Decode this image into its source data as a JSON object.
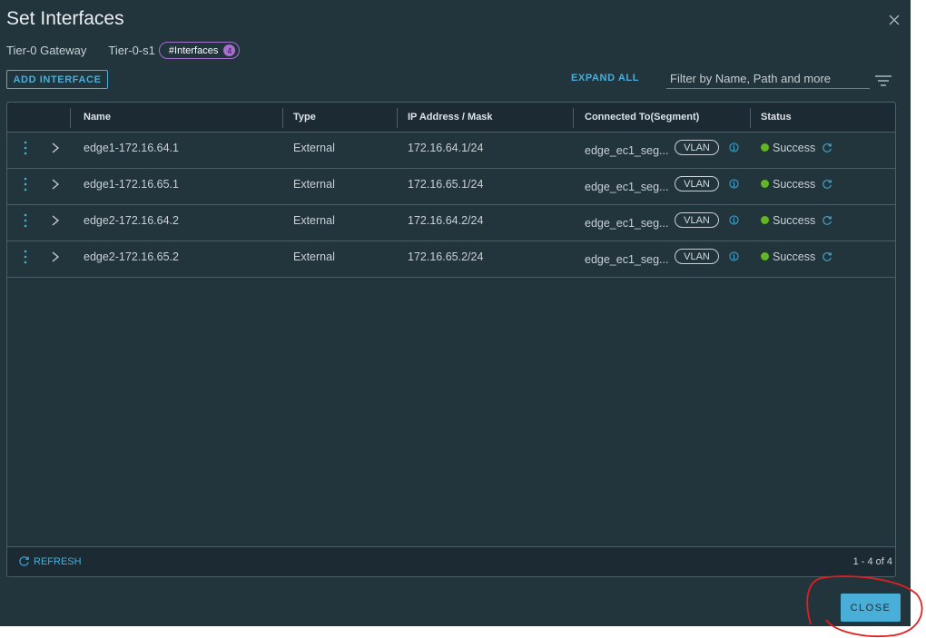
{
  "modal": {
    "title": "Set Interfaces",
    "breadcrumb": {
      "gateway_type": "Tier-0 Gateway",
      "gateway_name": "Tier-0-s1",
      "interfaces_pill_label": "#Interfaces",
      "interfaces_count": "4"
    },
    "toolbar": {
      "add_interface_label": "ADD INTERFACE",
      "expand_all_label": "EXPAND ALL",
      "filter_placeholder": "Filter by Name, Path and more",
      "filter_value": ""
    },
    "table": {
      "columns": [
        "Name",
        "Type",
        "IP Address / Mask",
        "Connected To(Segment)",
        "Status"
      ],
      "rows": [
        {
          "name": "edge1-172.16.64.1",
          "type": "External",
          "ip": "172.16.64.1/24",
          "segment": "edge_ec1_seg...",
          "segment_badge": "VLAN",
          "status": "Success"
        },
        {
          "name": "edge1-172.16.65.1",
          "type": "External",
          "ip": "172.16.65.1/24",
          "segment": "edge_ec1_seg...",
          "segment_badge": "VLAN",
          "status": "Success"
        },
        {
          "name": "edge2-172.16.64.2",
          "type": "External",
          "ip": "172.16.64.2/24",
          "segment": "edge_ec1_seg...",
          "segment_badge": "VLAN",
          "status": "Success"
        },
        {
          "name": "edge2-172.16.65.2",
          "type": "External",
          "ip": "172.16.65.2/24",
          "segment": "edge_ec1_seg...",
          "segment_badge": "VLAN",
          "status": "Success"
        }
      ],
      "footer": {
        "refresh_label": "REFRESH",
        "pagination": "1 - 4 of 4"
      }
    },
    "close_label": "CLOSE"
  },
  "colors": {
    "accent": "#49afd9",
    "success": "#62b623",
    "pill_border": "#a370cc",
    "annotation": "#e02020"
  }
}
